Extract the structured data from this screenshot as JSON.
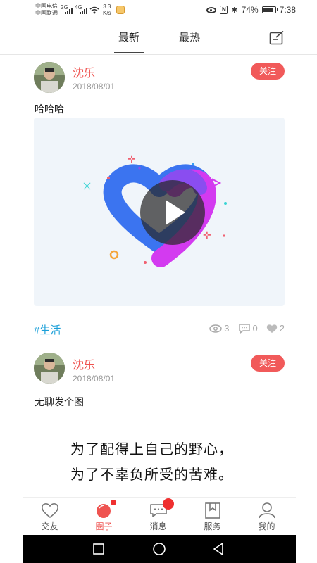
{
  "status_bar": {
    "carrier1": "中国电信",
    "carrier2": "中国联通",
    "net1": "2G",
    "net2": "4G",
    "speed_value": "3.3",
    "speed_unit": "K/s",
    "battery": "74%",
    "time": "7:38"
  },
  "header": {
    "tabs": [
      {
        "label": "最新",
        "active": true
      },
      {
        "label": "最热",
        "active": false
      }
    ],
    "edit_icon": "edit-icon"
  },
  "posts": [
    {
      "username": "沈乐",
      "date": "2018/08/01",
      "follow_label": "关注",
      "text": "哈哈哈",
      "has_video": true,
      "tag": "#生活",
      "views": "3",
      "comments": "0",
      "likes": "2"
    },
    {
      "username": "沈乐",
      "date": "2018/08/01",
      "follow_label": "关注",
      "text": "无聊发个图",
      "image_line1": "为了配得上自己的野心，",
      "image_line2": "为了不辜负所受的苦难。"
    }
  ],
  "bottom_nav": [
    {
      "label": "交友",
      "icon": "heart-icon",
      "active": false
    },
    {
      "label": "圈子",
      "icon": "circle-icon",
      "active": true,
      "badge": true
    },
    {
      "label": "消息",
      "icon": "message-icon",
      "active": false,
      "badge": true
    },
    {
      "label": "服务",
      "icon": "bookmark-icon",
      "active": false
    },
    {
      "label": "我的",
      "icon": "person-icon",
      "active": false
    }
  ],
  "colors": {
    "accent": "#ef5350",
    "tag": "#1a9fd8",
    "follow_bg": "#f15a5a"
  }
}
